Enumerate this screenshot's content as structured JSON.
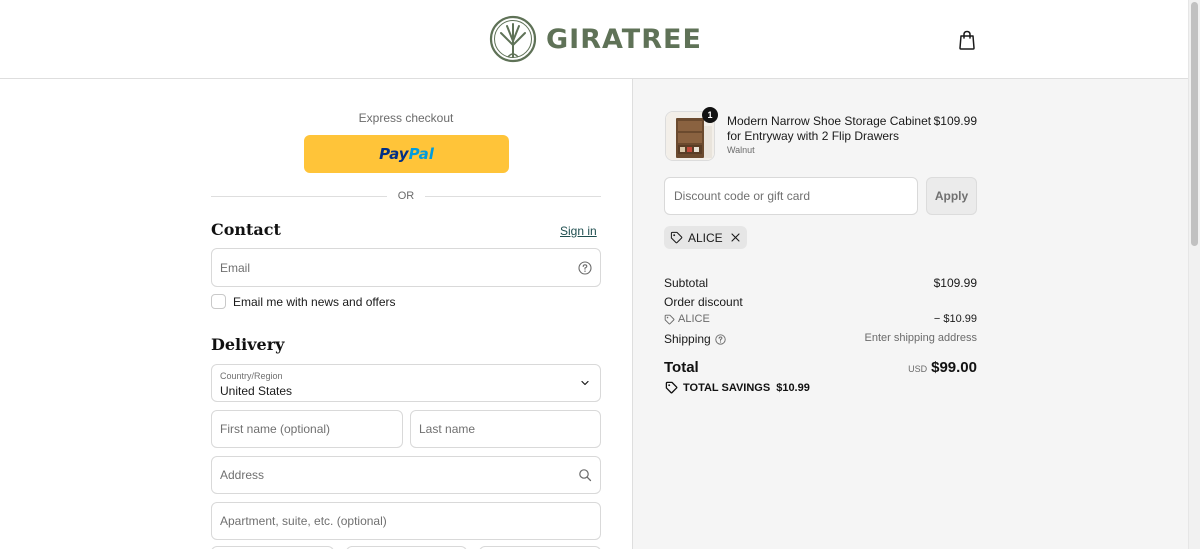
{
  "brand": {
    "name": "GIRATREE",
    "color": "#5f7257",
    "icons": {
      "logo": "tree-logo-icon",
      "cart": "shopping-bag-icon"
    }
  },
  "express": {
    "label": "Express checkout",
    "paypal_pay": "Pay",
    "paypal_pal": "Pal",
    "divider": "OR"
  },
  "contact": {
    "title": "Contact",
    "sign_in": "Sign in",
    "email_placeholder": "Email",
    "newsletter_label": "Email me with news and offers",
    "newsletter_checked": false
  },
  "delivery": {
    "title": "Delivery",
    "country_label": "Country/Region",
    "country_value": "United States",
    "first_name_placeholder": "First name (optional)",
    "last_name_placeholder": "Last name",
    "address_placeholder": "Address",
    "apartment_placeholder": "Apartment, suite, etc. (optional)"
  },
  "order": {
    "item": {
      "name": "Modern Narrow Shoe Storage Cabinet for Entryway with 2 Flip Drawers",
      "variant": "Walnut",
      "price": "$109.99",
      "quantity": "1"
    },
    "discount_placeholder": "Discount code or gift card",
    "apply_label": "Apply",
    "applied_code": "ALICE",
    "subtotal_label": "Subtotal",
    "subtotal_value": "$109.99",
    "order_discount_label": "Order discount",
    "discount_code": "ALICE",
    "discount_value": "− $10.99",
    "shipping_label": "Shipping",
    "shipping_value": "Enter shipping address",
    "total_label": "Total",
    "currency": "USD",
    "total_value": "$99.00",
    "savings_label": "TOTAL SAVINGS",
    "savings_value": "$10.99"
  },
  "colors": {
    "paypal": "#ffc439",
    "summary_bg": "#f5f5f5",
    "link": "#1f4e4f"
  }
}
